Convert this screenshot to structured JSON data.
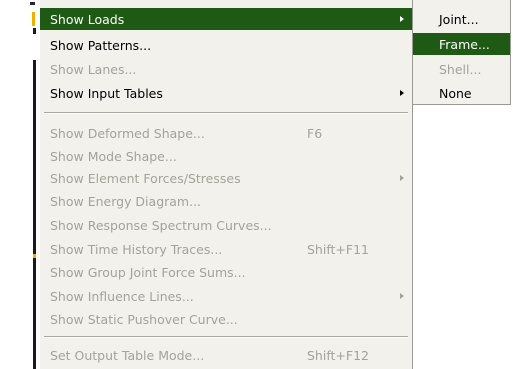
{
  "menu": {
    "group1": [
      {
        "label": "Show Loads",
        "submenu": true,
        "state": "highlighted"
      },
      {
        "label": "Show Patterns...",
        "state": "enabled"
      },
      {
        "label": "Show Lanes...",
        "state": "disabled"
      },
      {
        "label": "Show Input Tables",
        "submenu": true,
        "state": "enabled"
      }
    ],
    "group2": [
      {
        "label": "Show Deformed Shape...",
        "shortcut": "F6",
        "state": "disabled"
      },
      {
        "label": "Show Mode Shape...",
        "state": "disabled"
      },
      {
        "label": "Show Element Forces/Stresses",
        "submenu": true,
        "state": "disabled"
      },
      {
        "label": "Show Energy Diagram...",
        "state": "disabled"
      },
      {
        "label": "Show Response Spectrum Curves...",
        "state": "disabled"
      },
      {
        "label": "Show Time History Traces...",
        "shortcut": "Shift+F11",
        "state": "disabled"
      },
      {
        "label": "Show Group Joint Force Sums...",
        "state": "disabled"
      },
      {
        "label": "Show Influence Lines...",
        "submenu": true,
        "state": "disabled"
      },
      {
        "label": "Show Static Pushover Curve...",
        "state": "disabled"
      }
    ],
    "group3": [
      {
        "label": "Set Output Table Mode...",
        "shortcut": "Shift+F12",
        "state": "disabled"
      }
    ]
  },
  "submenu": {
    "items": [
      {
        "label": "Joint...",
        "state": "enabled"
      },
      {
        "label": "Frame...",
        "state": "highlighted"
      },
      {
        "label": "Shell...",
        "state": "disabled"
      },
      {
        "label": "None",
        "state": "enabled"
      }
    ]
  },
  "colors": {
    "menu_background": "#f2f1ec",
    "highlight": "#1e5a14",
    "disabled_text": "#a3a39c"
  }
}
